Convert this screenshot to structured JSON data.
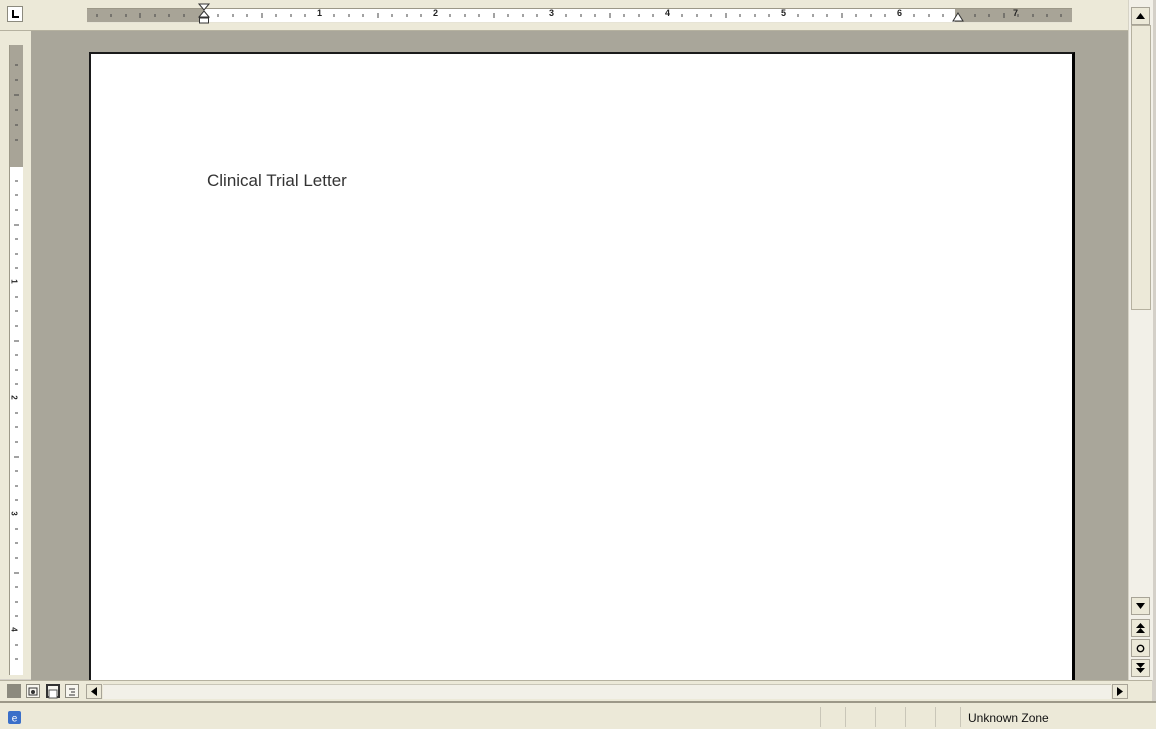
{
  "document": {
    "heading": "Clinical Trial Letter"
  },
  "ruler": {
    "numbers": [
      "1",
      "2",
      "3",
      "4",
      "5",
      "6",
      "7"
    ]
  },
  "statusbar": {
    "zone": "Unknown Zone"
  },
  "icons": {
    "tab_selector": "tab-stop-left-icon",
    "indent_left": "hanging-indent-icon",
    "indent_right": "right-indent-icon",
    "scroll_up": "arrow-up-icon",
    "scroll_down": "arrow-down-icon",
    "prev_page": "double-arrow-up-icon",
    "select_browse": "circle-icon",
    "next_page": "double-arrow-down-icon",
    "scroll_left": "arrow-left-icon",
    "scroll_right": "arrow-right-icon",
    "status_zone": "internet-explorer-icon"
  },
  "colors": {
    "workspace": "#a9a69a",
    "chrome": "#ece9d8",
    "ruler_margin": "#a8a497",
    "page": "#ffffff"
  }
}
